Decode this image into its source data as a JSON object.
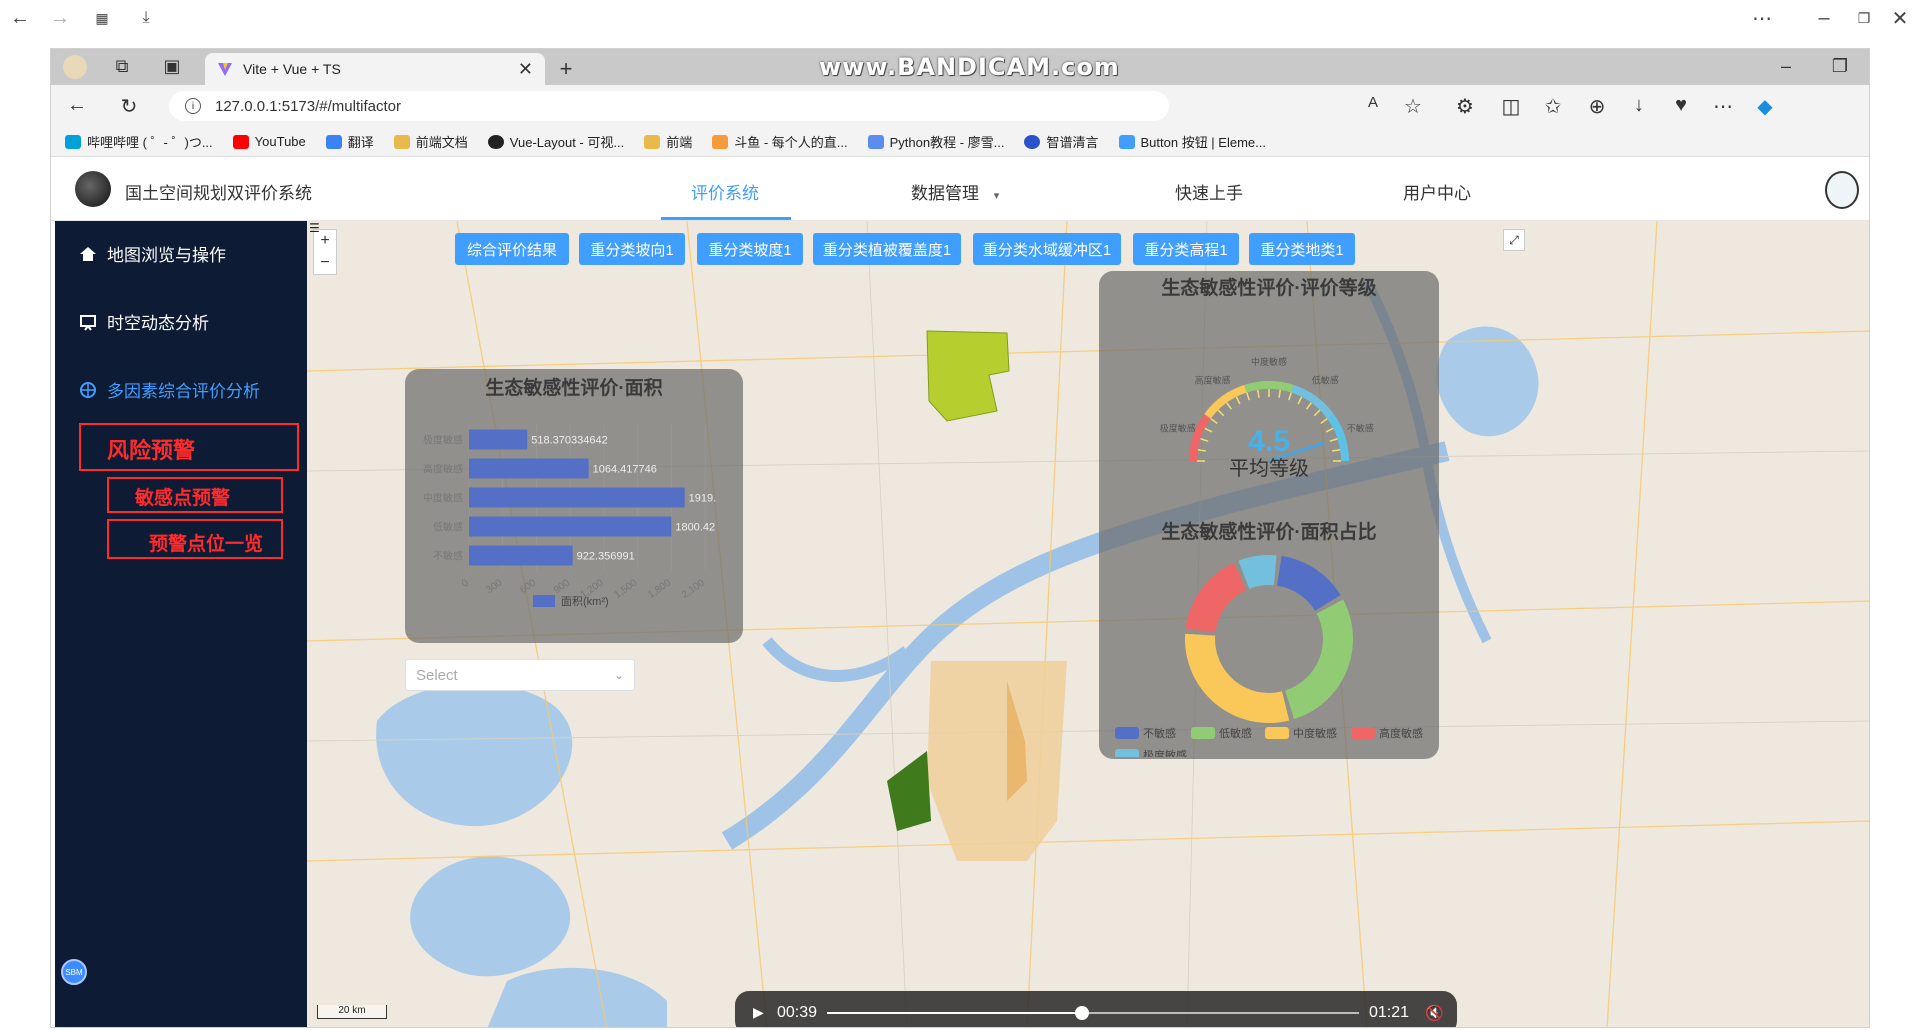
{
  "browser": {
    "tab_title": "Vite + Vue + TS",
    "url": "127.0.0.1:5173/#/multifactor",
    "watermark": "www.BANDICAM.com",
    "bookmarks": [
      "哔哩哔哩 ( ゜- ゜)つ...",
      "YouTube",
      "翻译",
      "前端文档",
      "Vue-Layout - 可视...",
      "前端",
      "斗鱼 - 每个人的直...",
      "Python教程 - 廖雪...",
      "智谱清言",
      "Button 按钮 | Eleme..."
    ]
  },
  "app": {
    "title": "国土空间规划双评价系统",
    "nav": [
      "评价系统",
      "数据管理",
      "快速上手",
      "用户中心"
    ],
    "sidebar": {
      "items": [
        "地图浏览与操作",
        "时空动态分析",
        "多因素综合评价分析"
      ],
      "boxed": [
        "风险预警",
        "敏感点预警",
        "预警点位一览"
      ],
      "badge": "SBM"
    },
    "map_buttons": [
      "综合评价结果",
      "重分类坡向1",
      "重分类坡度1",
      "重分类植被覆盖度1",
      "重分类水域缓冲区1",
      "重分类高程1",
      "重分类地类1"
    ],
    "scale_label": "20 km",
    "select_placeholder": "Select"
  },
  "charts": {
    "area_title": "生态敏感性评价·面积",
    "grade_title": "生态敏感性评价·评价等级",
    "ratio_title": "生态敏感性评价·面积占比",
    "gauge_label": "平均等级",
    "area_legend": "面积(km²)"
  },
  "chart_data": [
    {
      "type": "bar",
      "title": "生态敏感性评价·面积",
      "orientation": "horizontal",
      "categories": [
        "极度敏感",
        "高度敏感",
        "中度敏感",
        "低敏感",
        "不敏感"
      ],
      "values": [
        518.370334642,
        1064.417746,
        1919,
        1800.42,
        922.356991
      ],
      "data_labels": [
        "518.370334642",
        "1064.417746",
        "1919.",
        "1800.42",
        "922.356991"
      ],
      "series": [
        {
          "name": "面积(km²)",
          "values": [
            518.370334642,
            1064.417746,
            1919,
            1800.42,
            922.356991
          ]
        }
      ],
      "xlim": [
        0,
        2100
      ],
      "xticks": [
        "0",
        "300",
        "600",
        "900",
        "1,200",
        "1,500",
        "1,800",
        "2,100"
      ],
      "color": "#5470c6"
    },
    {
      "type": "gauge",
      "title": "生态敏感性评价·评价等级",
      "value": 4.5,
      "value_label": "4.5",
      "label": "平均等级",
      "range_labels": [
        "极度敏感",
        "高度敏感",
        "中度敏感",
        "低敏感",
        "不敏感"
      ]
    },
    {
      "type": "pie",
      "title": "生态敏感性评价·面积占比",
      "categories": [
        "不敏感",
        "低敏感",
        "中度敏感",
        "高度敏感",
        "极度敏感"
      ],
      "values": [
        922.356991,
        1800.42,
        1919,
        1064.417746,
        518.370334642
      ],
      "colors": [
        "#5470c6",
        "#91cc75",
        "#fac858",
        "#ee6666",
        "#73c0de"
      ]
    }
  ],
  "player": {
    "current": "00:39",
    "duration": "01:21",
    "progress": 0.48
  }
}
